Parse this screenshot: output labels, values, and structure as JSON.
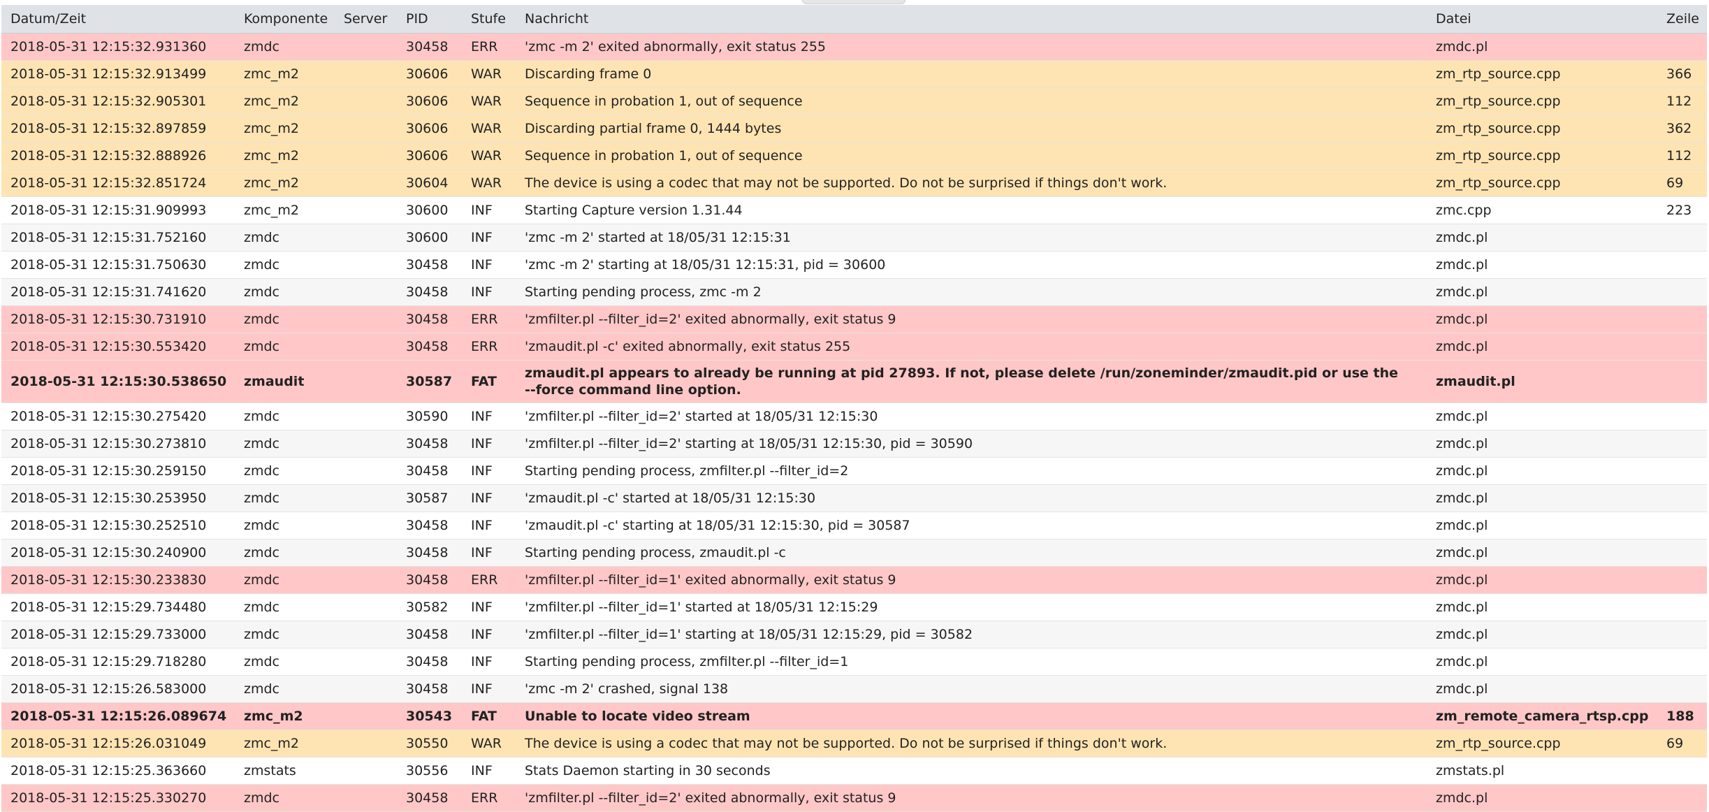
{
  "headers": {
    "datetime": "Datum/Zeit",
    "component": "Komponente",
    "server": "Server",
    "pid": "PID",
    "level": "Stufe",
    "message": "Nachricht",
    "file": "Datei",
    "line": "Zeile"
  },
  "level_colors": {
    "ERR": "#ffc7c7",
    "FAT": "#ffc7c7",
    "WAR": "#ffe4b3",
    "INF": "#ffffff"
  },
  "rows": [
    {
      "datetime": "2018-05-31 12:15:32.931360",
      "component": "zmdc",
      "server": "",
      "pid": "30458",
      "level": "ERR",
      "message": "'zmc -m 2' exited abnormally, exit status 255",
      "file": "zmdc.pl",
      "line": ""
    },
    {
      "datetime": "2018-05-31 12:15:32.913499",
      "component": "zmc_m2",
      "server": "",
      "pid": "30606",
      "level": "WAR",
      "message": "Discarding frame 0",
      "file": "zm_rtp_source.cpp",
      "line": "366"
    },
    {
      "datetime": "2018-05-31 12:15:32.905301",
      "component": "zmc_m2",
      "server": "",
      "pid": "30606",
      "level": "WAR",
      "message": "Sequence in probation 1, out of sequence",
      "file": "zm_rtp_source.cpp",
      "line": "112"
    },
    {
      "datetime": "2018-05-31 12:15:32.897859",
      "component": "zmc_m2",
      "server": "",
      "pid": "30606",
      "level": "WAR",
      "message": "Discarding partial frame 0, 1444 bytes",
      "file": "zm_rtp_source.cpp",
      "line": "362"
    },
    {
      "datetime": "2018-05-31 12:15:32.888926",
      "component": "zmc_m2",
      "server": "",
      "pid": "30606",
      "level": "WAR",
      "message": "Sequence in probation 1, out of sequence",
      "file": "zm_rtp_source.cpp",
      "line": "112"
    },
    {
      "datetime": "2018-05-31 12:15:32.851724",
      "component": "zmc_m2",
      "server": "",
      "pid": "30604",
      "level": "WAR",
      "message": "The device is using a codec that may not be supported. Do not be surprised if things don't work.",
      "file": "zm_rtp_source.cpp",
      "line": "69"
    },
    {
      "datetime": "2018-05-31 12:15:31.909993",
      "component": "zmc_m2",
      "server": "",
      "pid": "30600",
      "level": "INF",
      "message": "Starting Capture version 1.31.44",
      "file": "zmc.cpp",
      "line": "223"
    },
    {
      "datetime": "2018-05-31 12:15:31.752160",
      "component": "zmdc",
      "server": "",
      "pid": "30600",
      "level": "INF",
      "message": "'zmc -m 2' started at 18/05/31 12:15:31",
      "file": "zmdc.pl",
      "line": ""
    },
    {
      "datetime": "2018-05-31 12:15:31.750630",
      "component": "zmdc",
      "server": "",
      "pid": "30458",
      "level": "INF",
      "message": "'zmc -m 2' starting at 18/05/31 12:15:31, pid = 30600",
      "file": "zmdc.pl",
      "line": ""
    },
    {
      "datetime": "2018-05-31 12:15:31.741620",
      "component": "zmdc",
      "server": "",
      "pid": "30458",
      "level": "INF",
      "message": "Starting pending process, zmc -m 2",
      "file": "zmdc.pl",
      "line": ""
    },
    {
      "datetime": "2018-05-31 12:15:30.731910",
      "component": "zmdc",
      "server": "",
      "pid": "30458",
      "level": "ERR",
      "message": "'zmfilter.pl --filter_id=2' exited abnormally, exit status 9",
      "file": "zmdc.pl",
      "line": ""
    },
    {
      "datetime": "2018-05-31 12:15:30.553420",
      "component": "zmdc",
      "server": "",
      "pid": "30458",
      "level": "ERR",
      "message": "'zmaudit.pl -c' exited abnormally, exit status 255",
      "file": "zmdc.pl",
      "line": ""
    },
    {
      "datetime": "2018-05-31 12:15:30.538650",
      "component": "zmaudit",
      "server": "",
      "pid": "30587",
      "level": "FAT",
      "message": "zmaudit.pl appears to already be running at pid 27893. If not, please delete /run/zoneminder/zmaudit.pid or use the --force command line option.",
      "file": "zmaudit.pl",
      "line": ""
    },
    {
      "datetime": "2018-05-31 12:15:30.275420",
      "component": "zmdc",
      "server": "",
      "pid": "30590",
      "level": "INF",
      "message": "'zmfilter.pl --filter_id=2' started at 18/05/31 12:15:30",
      "file": "zmdc.pl",
      "line": ""
    },
    {
      "datetime": "2018-05-31 12:15:30.273810",
      "component": "zmdc",
      "server": "",
      "pid": "30458",
      "level": "INF",
      "message": "'zmfilter.pl --filter_id=2' starting at 18/05/31 12:15:30, pid = 30590",
      "file": "zmdc.pl",
      "line": ""
    },
    {
      "datetime": "2018-05-31 12:15:30.259150",
      "component": "zmdc",
      "server": "",
      "pid": "30458",
      "level": "INF",
      "message": "Starting pending process, zmfilter.pl --filter_id=2",
      "file": "zmdc.pl",
      "line": ""
    },
    {
      "datetime": "2018-05-31 12:15:30.253950",
      "component": "zmdc",
      "server": "",
      "pid": "30587",
      "level": "INF",
      "message": "'zmaudit.pl -c' started at 18/05/31 12:15:30",
      "file": "zmdc.pl",
      "line": ""
    },
    {
      "datetime": "2018-05-31 12:15:30.252510",
      "component": "zmdc",
      "server": "",
      "pid": "30458",
      "level": "INF",
      "message": "'zmaudit.pl -c' starting at 18/05/31 12:15:30, pid = 30587",
      "file": "zmdc.pl",
      "line": ""
    },
    {
      "datetime": "2018-05-31 12:15:30.240900",
      "component": "zmdc",
      "server": "",
      "pid": "30458",
      "level": "INF",
      "message": "Starting pending process, zmaudit.pl -c",
      "file": "zmdc.pl",
      "line": ""
    },
    {
      "datetime": "2018-05-31 12:15:30.233830",
      "component": "zmdc",
      "server": "",
      "pid": "30458",
      "level": "ERR",
      "message": "'zmfilter.pl --filter_id=1' exited abnormally, exit status 9",
      "file": "zmdc.pl",
      "line": ""
    },
    {
      "datetime": "2018-05-31 12:15:29.734480",
      "component": "zmdc",
      "server": "",
      "pid": "30582",
      "level": "INF",
      "message": "'zmfilter.pl --filter_id=1' started at 18/05/31 12:15:29",
      "file": "zmdc.pl",
      "line": ""
    },
    {
      "datetime": "2018-05-31 12:15:29.733000",
      "component": "zmdc",
      "server": "",
      "pid": "30458",
      "level": "INF",
      "message": "'zmfilter.pl --filter_id=1' starting at 18/05/31 12:15:29, pid = 30582",
      "file": "zmdc.pl",
      "line": ""
    },
    {
      "datetime": "2018-05-31 12:15:29.718280",
      "component": "zmdc",
      "server": "",
      "pid": "30458",
      "level": "INF",
      "message": "Starting pending process, zmfilter.pl --filter_id=1",
      "file": "zmdc.pl",
      "line": ""
    },
    {
      "datetime": "2018-05-31 12:15:26.583000",
      "component": "zmdc",
      "server": "",
      "pid": "30458",
      "level": "INF",
      "message": "'zmc -m 2' crashed, signal 138",
      "file": "zmdc.pl",
      "line": ""
    },
    {
      "datetime": "2018-05-31 12:15:26.089674",
      "component": "zmc_m2",
      "server": "",
      "pid": "30543",
      "level": "FAT",
      "message": "Unable to locate video stream",
      "file": "zm_remote_camera_rtsp.cpp",
      "line": "188"
    },
    {
      "datetime": "2018-05-31 12:15:26.031049",
      "component": "zmc_m2",
      "server": "",
      "pid": "30550",
      "level": "WAR",
      "message": "The device is using a codec that may not be supported. Do not be surprised if things don't work.",
      "file": "zm_rtp_source.cpp",
      "line": "69"
    },
    {
      "datetime": "2018-05-31 12:15:25.363660",
      "component": "zmstats",
      "server": "",
      "pid": "30556",
      "level": "INF",
      "message": "Stats Daemon starting in 30 seconds",
      "file": "zmstats.pl",
      "line": ""
    },
    {
      "datetime": "2018-05-31 12:15:25.330270",
      "component": "zmdc",
      "server": "",
      "pid": "30458",
      "level": "ERR",
      "message": "'zmfilter.pl --filter_id=2' exited abnormally, exit status 9",
      "file": "zmdc.pl",
      "line": ""
    }
  ]
}
